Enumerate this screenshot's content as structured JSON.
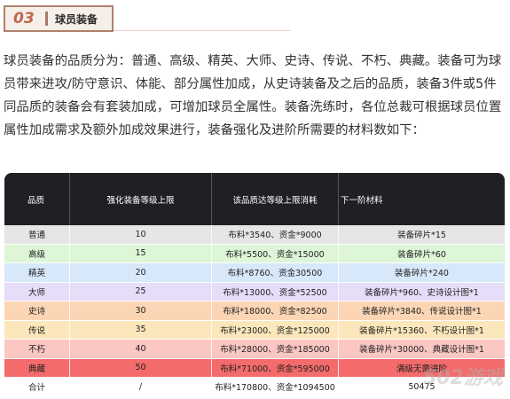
{
  "section": {
    "number": "03",
    "title": "球员装备"
  },
  "paragraph": "球员装备的品质分为：普通、高级、精英、大师、史诗、传说、不朽、典藏。装备可为球员带来进攻/防守意识、体能、部分属性加成，从史诗装备及之后的品质，装备3件或5件同品质的装备会有套装加成，可增加球员全属性。装备洗练时，各位总裁可根据球员位置属性加成需求及额外加成效果进行，装备强化及进阶所需要的材料数如下：",
  "table": {
    "headers": [
      "品质",
      "强化装备等级上限",
      "该品质达等级上限消耗",
      "下一阶材料"
    ],
    "rows": [
      {
        "quality": "普通",
        "level": "10",
        "cost": "布料*3540、资金*9000",
        "next": "装备碎片*15",
        "color": "#e6e6e6"
      },
      {
        "quality": "高级",
        "level": "15",
        "cost": "布料*5500、资金*15000",
        "next": "装备碎片*60",
        "color": "#dcf6d7"
      },
      {
        "quality": "精英",
        "level": "20",
        "cost": "布料*8760、资金30500",
        "next": "装备碎片*240",
        "color": "#d8e8fb"
      },
      {
        "quality": "大师",
        "level": "25",
        "cost": "布料*13000、资金*52500",
        "next": "装备碎片*960、史诗设计图*1",
        "color": "#e6ddf9"
      },
      {
        "quality": "史诗",
        "level": "30",
        "cost": "布料*18000、资金*82500",
        "next": "装备碎片*3840、传说设计图*1",
        "color": "#fbd5b4"
      },
      {
        "quality": "传说",
        "level": "35",
        "cost": "布料*23000、资金*125000",
        "next": "装备碎片*15360、不朽设计图*1",
        "color": "#fbe7bb"
      },
      {
        "quality": "不朽",
        "level": "40",
        "cost": "布料*28000、资金*185000",
        "next": "装备碎片*30000、典藏设计图*1",
        "color": "#fbc7c3"
      },
      {
        "quality": "典藏",
        "level": "50",
        "cost": "布料*71000、资金*595000",
        "next": "满级无需进阶",
        "color": "#f36b6b"
      },
      {
        "quality": "合计",
        "level": "/",
        "cost": "布料*170800、资金*1094500",
        "next": "50475",
        "color": "#ffffff"
      }
    ]
  },
  "watermark": "502游戏"
}
